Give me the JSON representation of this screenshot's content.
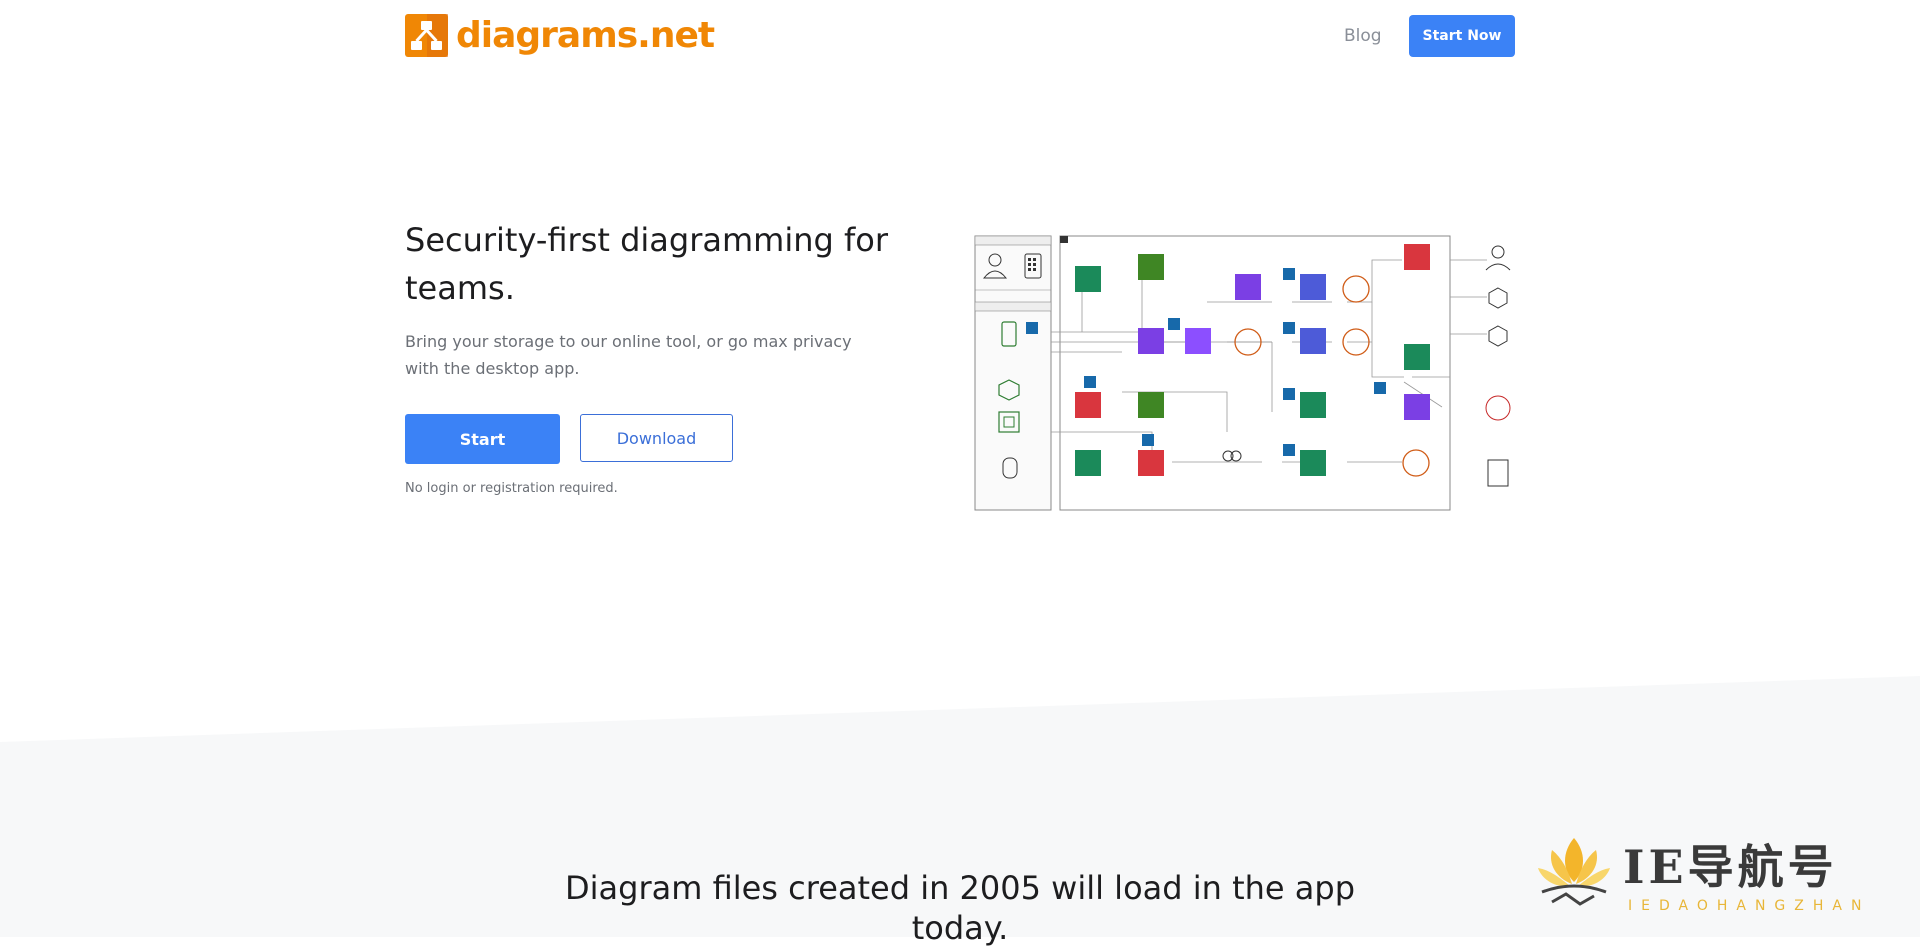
{
  "header": {
    "logo_text": "diagrams.net",
    "nav_blog": "Blog",
    "nav_start": "Start Now"
  },
  "hero": {
    "title": "Security-first diagramming for teams.",
    "subtitle": "Bring your storage to our online tool, or go max privacy with the desktop app.",
    "primary_button": "Start",
    "secondary_button": "Download",
    "note": "No login or registration required."
  },
  "section": {
    "title": "Diagram files created in 2005 will load in the app today."
  },
  "watermark": {
    "brand": "IE导航号",
    "sub": "IEDAOHANGZHAN"
  },
  "colors": {
    "brand_orange": "#f08705",
    "primary_blue": "#3b82f6",
    "outline_blue": "#3b6fd8"
  }
}
